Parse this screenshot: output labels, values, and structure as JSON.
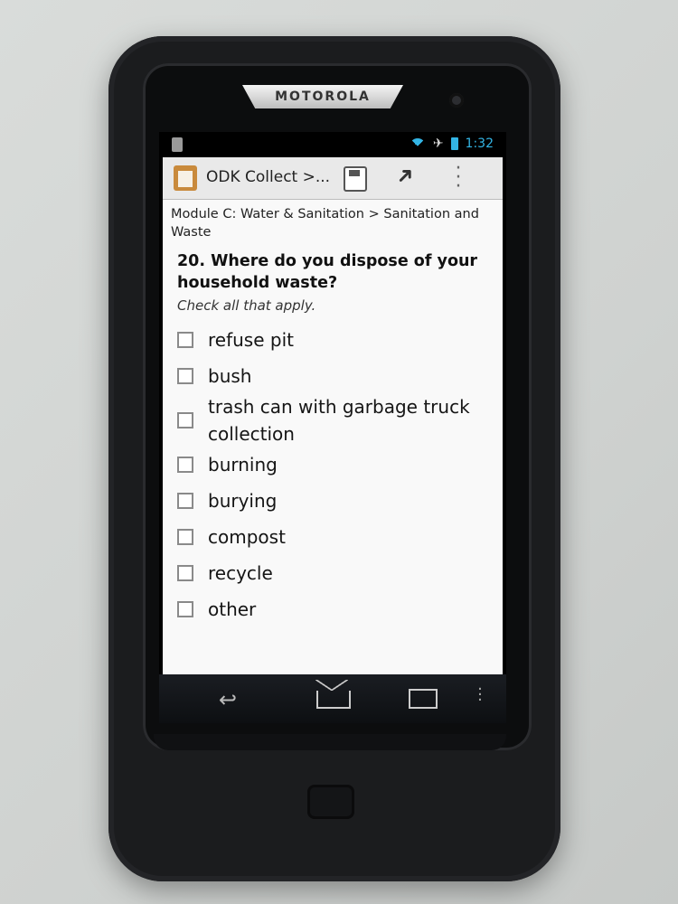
{
  "device": {
    "brand": "MOTOROLA"
  },
  "status_bar": {
    "time": "1:32"
  },
  "action_bar": {
    "title": "ODK Collect >...",
    "icons": [
      "app-clipboard-icon",
      "save-icon",
      "goto-arrow-icon",
      "overflow-menu-icon"
    ]
  },
  "form": {
    "breadcrumb": "Module C: Water & Sanitation > Sanitation and Waste",
    "question": "20. Where do you dispose of your household waste?",
    "hint": "Check all that apply.",
    "options": [
      {
        "label": "refuse pit",
        "checked": false
      },
      {
        "label": "bush",
        "checked": false
      },
      {
        "label": "trash can with garbage truck collection",
        "checked": false
      },
      {
        "label": "burning",
        "checked": false
      },
      {
        "label": "burying",
        "checked": false
      },
      {
        "label": "compost",
        "checked": false
      },
      {
        "label": "recycle",
        "checked": false
      },
      {
        "label": "other",
        "checked": false
      }
    ]
  },
  "nav_bar": {
    "icons": [
      "back-icon",
      "home-icon",
      "recent-apps-icon",
      "menu-icon"
    ]
  },
  "colors": {
    "accent": "#33b5e5",
    "screen_bg": "#f9f9f9",
    "action_bar_bg": "#e9e9e9"
  }
}
